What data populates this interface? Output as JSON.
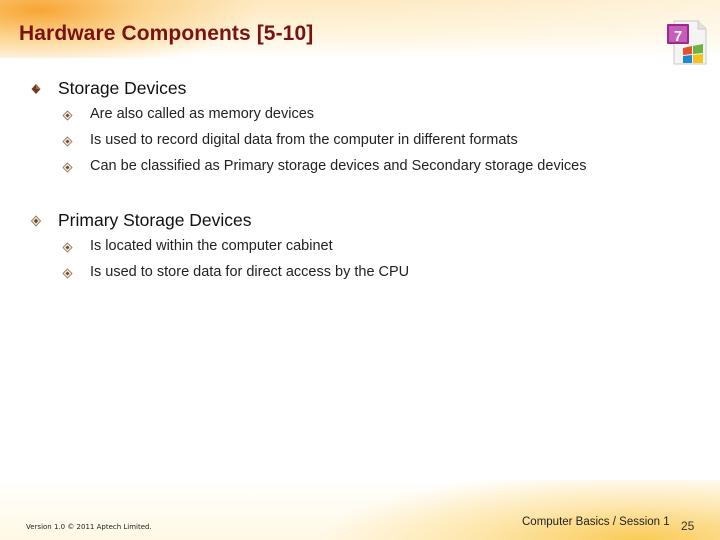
{
  "slide": {
    "title": "Hardware Components [5-10]",
    "logo_icon": "office-app-logo-icon",
    "sections": [
      {
        "heading": "Storage Devices",
        "bullet_icon": "filled-diamond-bullet-icon",
        "items": [
          "Are also called as memory devices",
          "Is used to record digital data from the computer in different formats",
          "Can be classified as Primary storage devices and Secondary storage devices"
        ]
      },
      {
        "heading": "Primary Storage Devices",
        "bullet_icon": "outline-diamond-bullet-icon",
        "items": [
          "Is located within the computer cabinet",
          "Is used to store data for direct access by the CPU"
        ]
      }
    ],
    "footer": {
      "copyright": "Version 1.0 © 2011 Aptech Limited.",
      "course": "Computer Basics / Session 1",
      "page_number": "25"
    },
    "colors": {
      "title": "#7a1212",
      "bullet_filled": "#6b3a1f",
      "header_accent": "#f7a028",
      "footer_accent": "#fac850"
    }
  }
}
